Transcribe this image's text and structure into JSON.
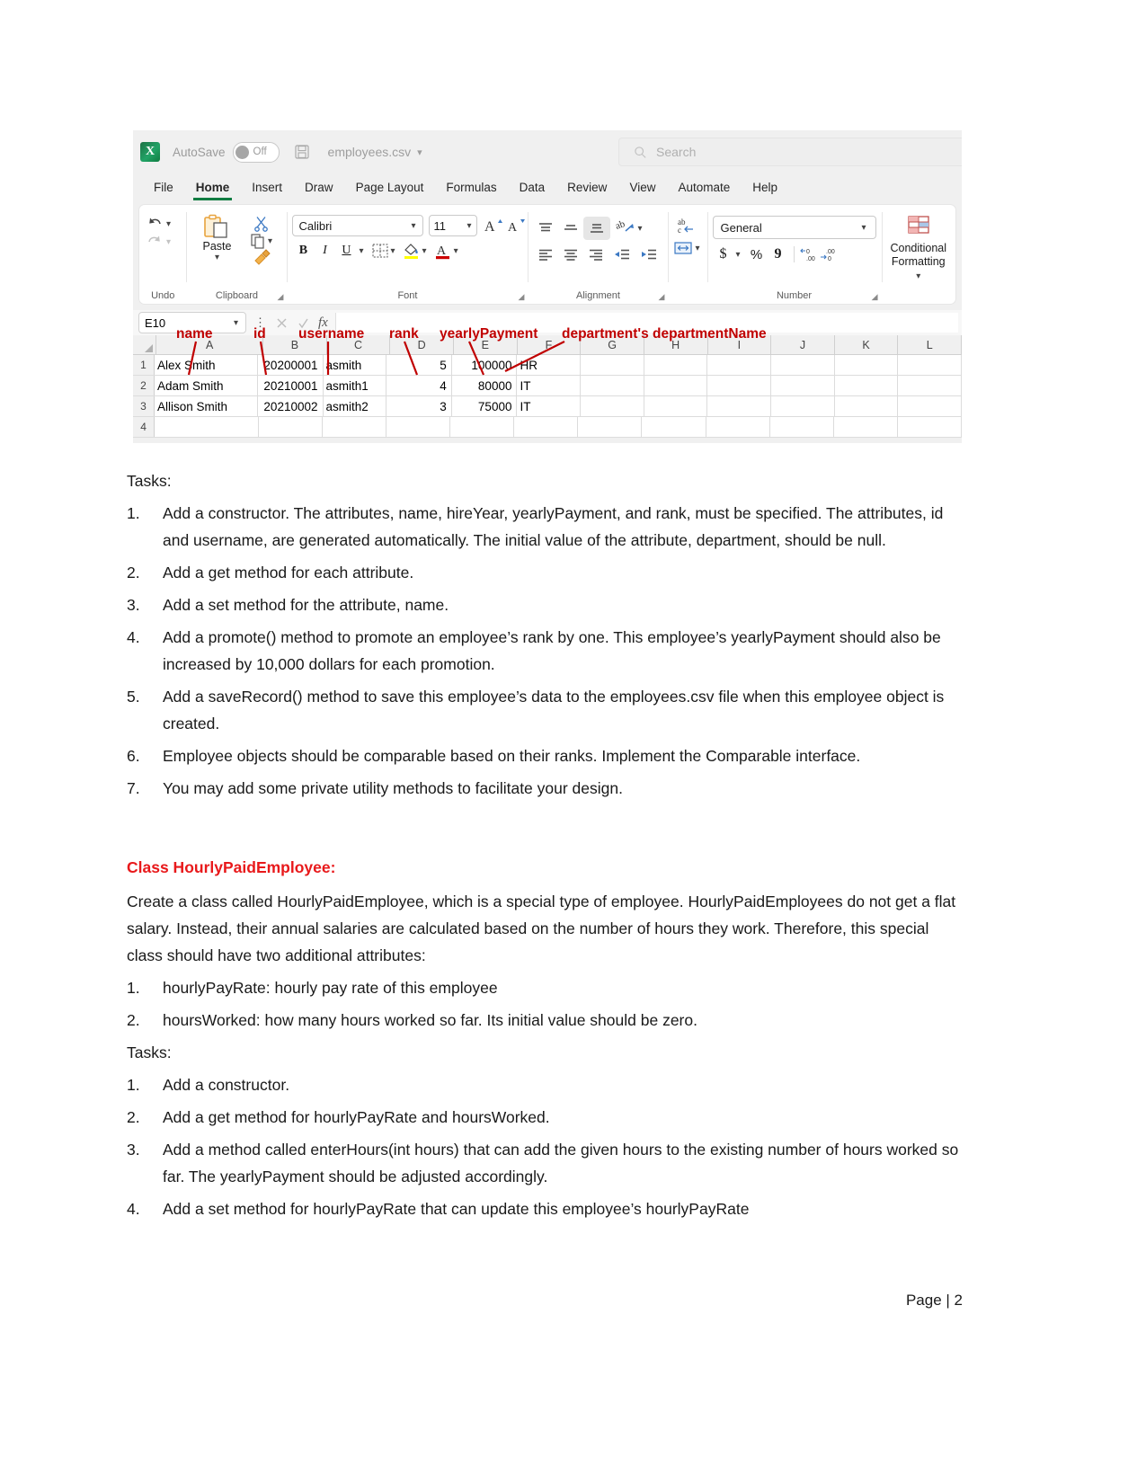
{
  "excel": {
    "logo_letter": "X",
    "autosave_label": "AutoSave",
    "autosave_state": "Off",
    "filename": "employees.csv",
    "search_placeholder": "Search",
    "tabs": [
      {
        "label": "File",
        "active": false
      },
      {
        "label": "Home",
        "active": true
      },
      {
        "label": "Insert",
        "active": false
      },
      {
        "label": "Draw",
        "active": false
      },
      {
        "label": "Page Layout",
        "active": false
      },
      {
        "label": "Formulas",
        "active": false
      },
      {
        "label": "Data",
        "active": false
      },
      {
        "label": "Review",
        "active": false
      },
      {
        "label": "View",
        "active": false
      },
      {
        "label": "Automate",
        "active": false
      },
      {
        "label": "Help",
        "active": false
      }
    ],
    "ribbon": {
      "undo_group_label": "Undo",
      "clipboard_group_label": "Clipboard",
      "paste_label": "Paste",
      "font_group_label": "Font",
      "font_name": "Calibri",
      "font_size": "11",
      "bold_label": "B",
      "italic_label": "I",
      "underline_label": "U",
      "alignment_group_label": "Alignment",
      "number_group_label": "Number",
      "number_format": "General",
      "currency_label": "$",
      "percent_label": "%",
      "comma_label": "9",
      "conditional_formatting_label_line1": "Conditional",
      "conditional_formatting_label_line2": "Formatting"
    },
    "formula_bar": {
      "name_box": "E10",
      "formula_value": ""
    },
    "grid": {
      "columns": [
        "A",
        "B",
        "C",
        "D",
        "E",
        "F",
        "G",
        "H",
        "I",
        "J",
        "K",
        "L"
      ],
      "row_numbers": [
        "1",
        "2",
        "3",
        "4"
      ],
      "rows": [
        [
          "Alex Smith",
          "20200001",
          "asmith",
          "5",
          "100000",
          "HR",
          "",
          "",
          "",
          "",
          "",
          ""
        ],
        [
          "Adam Smith",
          "20210001",
          "asmith1",
          "4",
          "80000",
          "IT",
          "",
          "",
          "",
          "",
          "",
          ""
        ],
        [
          "Allison Smith",
          "20210002",
          "asmith2",
          "3",
          "75000",
          "IT",
          "",
          "",
          "",
          "",
          "",
          ""
        ],
        [
          "",
          "",
          "",
          "",
          "",
          "",
          "",
          "",
          "",
          "",
          "",
          ""
        ]
      ]
    },
    "annotations": [
      {
        "label": "name"
      },
      {
        "label": "id"
      },
      {
        "label": "username"
      },
      {
        "label": "rank"
      },
      {
        "label": "yearlyPayment"
      },
      {
        "label": "department's departmentName"
      }
    ],
    "annotation_color": "#c00000"
  },
  "document": {
    "tasks_label_1": "Tasks:",
    "tasks_1": [
      {
        "num": "1.",
        "text": "Add a constructor. The attributes, name, hireYear, yearlyPayment, and rank, must be specified. The attributes, id and username, are generated automatically. The initial value of the attribute, department, should be null."
      },
      {
        "num": "2.",
        "text": "Add a get method for each attribute."
      },
      {
        "num": "3.",
        "text": "Add a set method for the attribute, name."
      },
      {
        "num": "4.",
        "text": "Add a promote() method to promote an employee’s rank by one. This employee’s yearlyPayment should also be increased by 10,000 dollars for each promotion."
      },
      {
        "num": "5.",
        "text": "Add a saveRecord() method to save this employee’s data to the employees.csv file when this employee object is created."
      },
      {
        "num": "6.",
        "text": "Employee objects should be comparable based on their ranks. Implement the Comparable interface."
      },
      {
        "num": "7.",
        "text": "You may add some private utility methods to facilitate your design."
      }
    ],
    "class_heading": "Class HourlyPaidEmployee:",
    "class_heading_color": "#e8191b",
    "class_paragraph": "Create a class called HourlyPaidEmployee, which is a special type of employee. HourlyPaidEmployees do not get a flat salary. Instead, their annual salaries are calculated based on the number of hours they work. Therefore, this special class should have two additional attributes:",
    "attributes": [
      {
        "num": "1.",
        "text": "hourlyPayRate: hourly pay rate of this employee"
      },
      {
        "num": "2.",
        "text": "hoursWorked: how many hours worked so far. Its initial value should be zero."
      }
    ],
    "tasks_label_2": "Tasks:",
    "tasks_2": [
      {
        "num": "1.",
        "text": "Add a constructor."
      },
      {
        "num": "2.",
        "text": "Add a get method for hourlyPayRate and hoursWorked."
      },
      {
        "num": "3.",
        "text": "Add a method called enterHours(int hours) that can add the given hours to the existing number of hours worked so far. The yearlyPayment should be adjusted accordingly."
      },
      {
        "num": "4.",
        "text": "Add a set method for hourlyPayRate that can update this employee’s hourlyPayRate"
      }
    ],
    "footer": "Page | 2"
  }
}
